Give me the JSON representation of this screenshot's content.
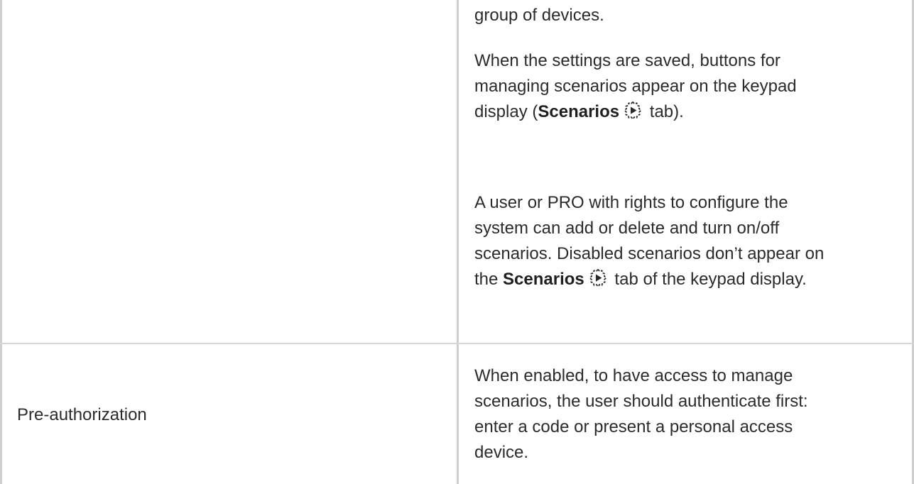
{
  "row1": {
    "para1": "group of devices.",
    "para2": {
      "line1": "When the settings are saved, buttons for",
      "line2": "managing scenarios appear on the keypad",
      "line3_pre": "display (",
      "line3_bold": "Scenarios",
      "line3_post": " tab)."
    },
    "para3": {
      "line1": "A user or PRO with rights to configure the",
      "line2": "system can add or delete and turn on/off",
      "line3": "scenarios. Disabled scenarios don’t appear on",
      "line4_pre": "the ",
      "line4_bold": "Scenarios",
      "line4_post": " tab of the keypad display."
    }
  },
  "row2": {
    "label": "Pre-authorization",
    "description": {
      "line1": "When enabled, to have access to manage",
      "line2": "scenarios, the user should authenticate first:",
      "line3": "enter a code or present a personal access",
      "line4": "device."
    }
  },
  "icons": {
    "scenarios": "scenarios-gear-play-icon"
  }
}
